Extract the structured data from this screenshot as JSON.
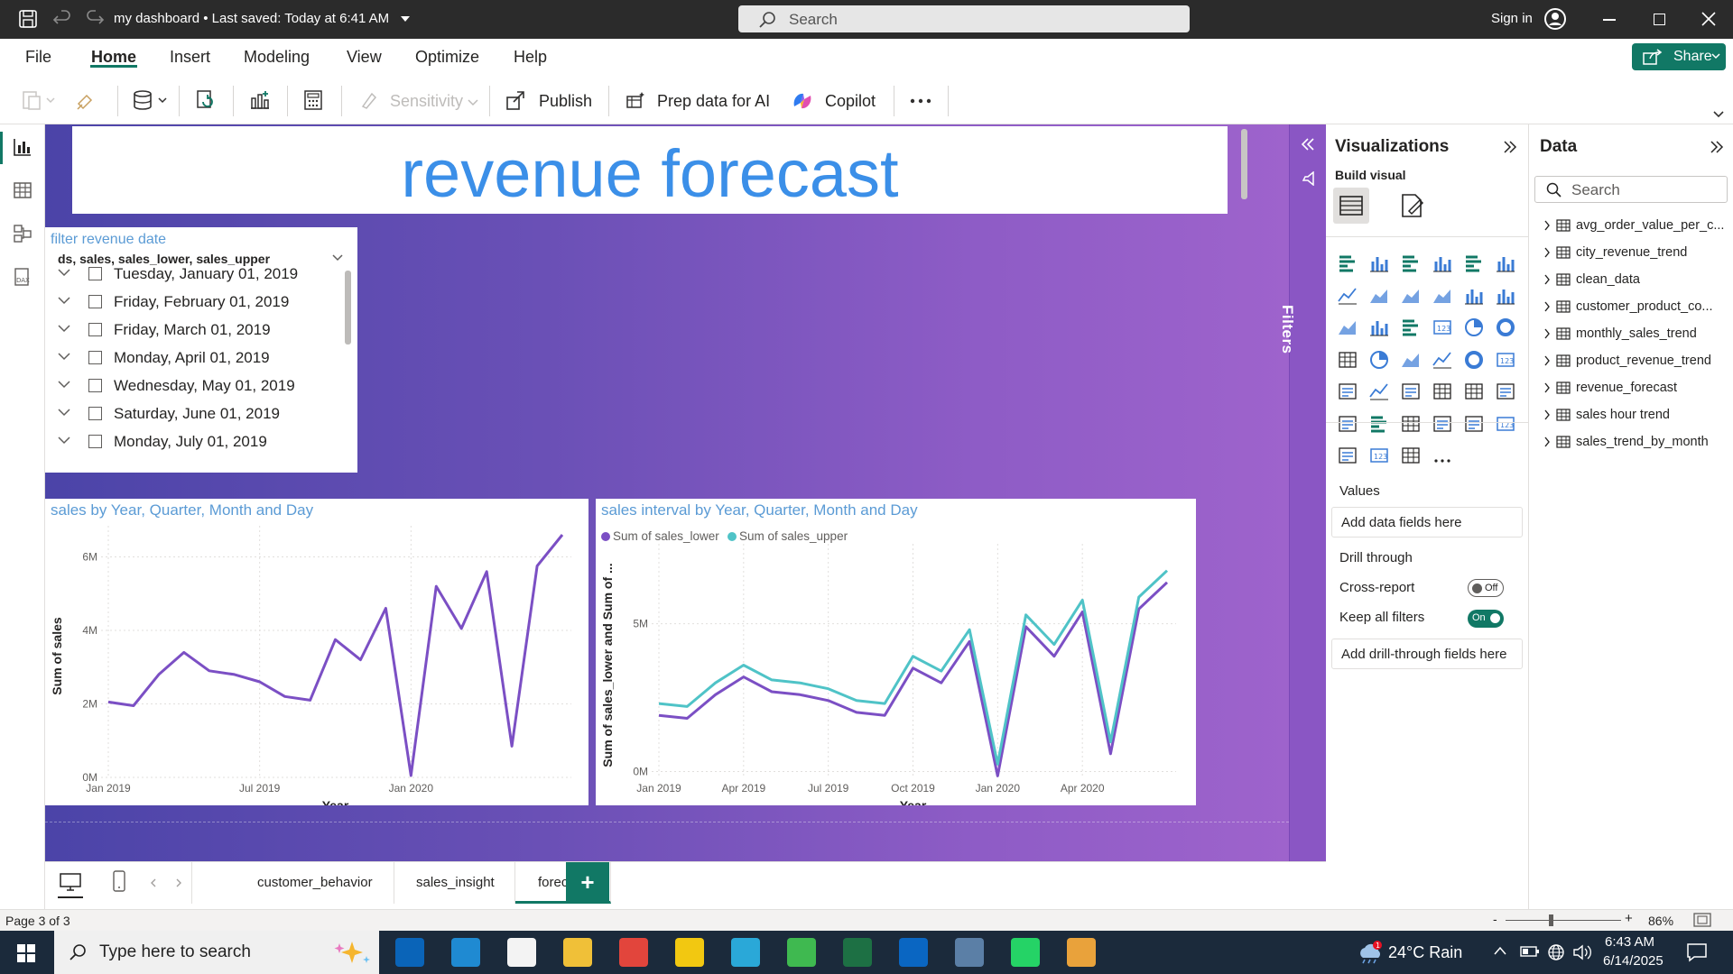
{
  "app": {
    "title": "my dashboard",
    "saved_status": "Last saved: Today at 6:41 AM",
    "search_placeholder": "Search",
    "sign_in": "Sign in"
  },
  "menu": {
    "items": [
      "File",
      "Home",
      "Insert",
      "Modeling",
      "View",
      "Optimize",
      "Help"
    ],
    "active": "Home",
    "share_label": "Share"
  },
  "ribbon": {
    "sensitivity": "Sensitivity",
    "publish": "Publish",
    "prep_data": "Prep data for AI",
    "copilot": "Copilot"
  },
  "report": {
    "title": "revenue forecast",
    "slicer": {
      "title": "filter revenue date",
      "header": "ds, sales, sales_lower, sales_upper",
      "items": [
        "Tuesday, January 01, 2019",
        "Friday, February 01, 2019",
        "Friday, March 01, 2019",
        "Monday, April 01, 2019",
        "Wednesday, May 01, 2019",
        "Saturday, June 01, 2019",
        "Monday, July 01, 2019"
      ]
    }
  },
  "chart_data": [
    {
      "type": "line",
      "title": "sales by Year, Quarter, Month and Day",
      "xlabel": "Year",
      "ylabel": "Sum of sales",
      "x_tick_labels": [
        "Jan 2019",
        "Jul 2019",
        "Jan 2020"
      ],
      "y_tick_labels": [
        "0M",
        "2M",
        "4M",
        "6M"
      ],
      "ylim": [
        0,
        6.6
      ],
      "unit": "M",
      "x": [
        "2019-01",
        "2019-02",
        "2019-03",
        "2019-04",
        "2019-05",
        "2019-06",
        "2019-07",
        "2019-08",
        "2019-09",
        "2019-10",
        "2019-11",
        "2019-12",
        "2020-01",
        "2020-02",
        "2020-03",
        "2020-04",
        "2020-05",
        "2020-06",
        "2020-07"
      ],
      "series": [
        {
          "color": "#7b4fc4",
          "values": [
            2.05,
            1.95,
            2.8,
            3.4,
            2.9,
            2.8,
            2.6,
            2.2,
            2.1,
            3.75,
            3.2,
            4.6,
            0.05,
            5.2,
            4.05,
            5.6,
            0.85,
            5.75,
            6.6
          ]
        }
      ],
      "grid": true
    },
    {
      "type": "line",
      "title": "sales interval by Year, Quarter, Month and Day",
      "xlabel": "Year",
      "ylabel": "Sum of sales_lower and Sum of ...",
      "x_tick_labels": [
        "Jan 2019",
        "Apr 2019",
        "Jul 2019",
        "Oct 2019",
        "Jan 2020",
        "Apr 2020"
      ],
      "y_tick_labels": [
        "0M",
        "5M"
      ],
      "legend": "top-left",
      "unit": "M",
      "x": [
        "2019-01",
        "2019-02",
        "2019-03",
        "2019-04",
        "2019-05",
        "2019-06",
        "2019-07",
        "2019-08",
        "2019-09",
        "2019-10",
        "2019-11",
        "2019-12",
        "2020-01",
        "2020-02",
        "2020-03",
        "2020-04",
        "2020-05",
        "2020-06",
        "2020-07"
      ],
      "series": [
        {
          "name": "Sum of sales_lower",
          "color": "#7b4fc4",
          "values": [
            1.9,
            1.8,
            2.6,
            3.2,
            2.7,
            2.6,
            2.4,
            2.0,
            1.9,
            3.5,
            3.0,
            4.4,
            -0.15,
            4.9,
            3.9,
            5.4,
            0.6,
            5.5,
            6.4
          ]
        },
        {
          "name": "Sum of sales_upper",
          "color": "#4fc3c7",
          "values": [
            2.3,
            2.2,
            3.0,
            3.6,
            3.1,
            3.0,
            2.8,
            2.4,
            2.3,
            3.9,
            3.4,
            4.8,
            0.25,
            5.3,
            4.3,
            5.8,
            1.0,
            5.9,
            6.8
          ]
        }
      ],
      "ylim": [
        -0.2,
        7.4
      ],
      "grid": true
    }
  ],
  "filters_label": "Filters",
  "visualizations": {
    "title": "Visualizations",
    "build_visual": "Build visual",
    "values_label": "Values",
    "values_placeholder": "Add data fields here",
    "drill_through": "Drill through",
    "cross_report": "Cross-report",
    "cross_report_state": "Off",
    "keep_all_filters": "Keep all filters",
    "keep_all_filters_state": "On",
    "drill_placeholder": "Add drill-through fields here"
  },
  "data_pane": {
    "title": "Data",
    "search_placeholder": "Search",
    "tables": [
      "avg_order_value_per_c...",
      "city_revenue_trend",
      "clean_data",
      "customer_product_co...",
      "monthly_sales_trend",
      "product_revenue_trend",
      "revenue_forecast",
      "sales hour trend",
      "sales_trend_by_month"
    ]
  },
  "pages": {
    "tabs": [
      "customer_behavior",
      "sales_insight",
      "forecast"
    ],
    "active": "forecast",
    "page_info": "Page 3 of 3",
    "zoom": "86%"
  },
  "taskbar": {
    "search_placeholder": "Type here to search",
    "weather": "24°C  Rain",
    "time": "6:43 AM",
    "date": "6/14/2025"
  },
  "colors": {
    "accent": "#117865",
    "canvas_start": "#4b44a8",
    "canvas_end": "#9e63cc",
    "title_blue": "#3b8fe8",
    "line_purple": "#7b4fc4",
    "line_teal": "#4fc3c7"
  }
}
